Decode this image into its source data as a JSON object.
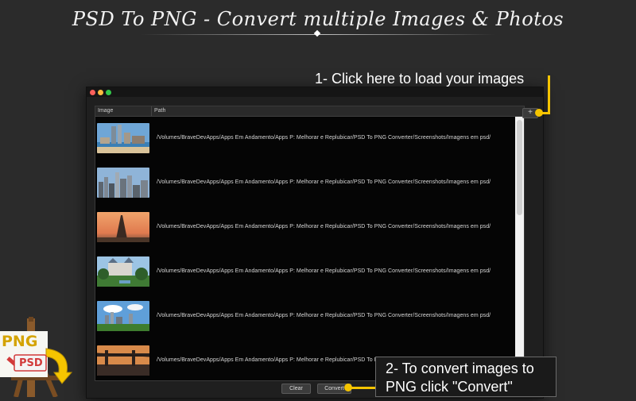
{
  "headline": "PSD To PNG - Convert multiple Images & Photos",
  "window": {
    "table": {
      "columns": [
        "Image",
        "Path"
      ],
      "rows": [
        {
          "path": "/Volumes/BraveDevApps/Apps Em Andamento/Apps P: Melhorar e Replubicar/PSD To PNG Converter/Screenshots/Imagens em psd/"
        },
        {
          "path": "/Volumes/BraveDevApps/Apps Em Andamento/Apps P: Melhorar e Replubicar/PSD To PNG Converter/Screenshots/Imagens em psd/"
        },
        {
          "path": "/Volumes/BraveDevApps/Apps Em Andamento/Apps P: Melhorar e Replubicar/PSD To PNG Converter/Screenshots/Imagens em psd/"
        },
        {
          "path": "/Volumes/BraveDevApps/Apps Em Andamento/Apps P: Melhorar e Replubicar/PSD To PNG Converter/Screenshots/Imagens em psd/"
        },
        {
          "path": "/Volumes/BraveDevApps/Apps Em Andamento/Apps P: Melhorar e Replubicar/PSD To PNG Converter/Screenshots/Imagens em psd/"
        },
        {
          "path": "/Volumes/BraveDevApps/Apps Em Andamento/Apps P: Melhorar e Replubicar/PSD To PNG Converter/Screenshots/Imagens em psd/"
        }
      ]
    },
    "add_button": "+",
    "clear_button": "Clear",
    "convert_button": "Convert"
  },
  "callouts": {
    "load": "1- Click here to load your images",
    "convert_line1": "2- To convert images to",
    "convert_line2": "PNG click \"Convert\""
  },
  "logo": {
    "top_text": "PNG",
    "bottom_text": "PSD"
  },
  "colors": {
    "accent": "#f5c400",
    "background": "#2b2b2b"
  }
}
